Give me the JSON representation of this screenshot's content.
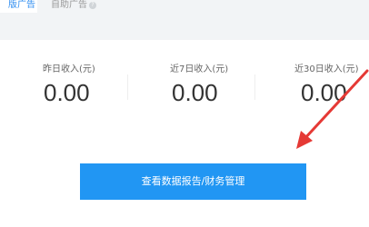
{
  "tabs": {
    "active_label": "版广告",
    "inactive_label": "自助广告"
  },
  "stats": [
    {
      "label": "昨日收入(元)",
      "value": "0.00"
    },
    {
      "label": "近7日收入(元)",
      "value": "0.00"
    },
    {
      "label": "近30日收入(元)",
      "value": "0.00"
    }
  ],
  "action": {
    "label": "查看数据报告/财务管理"
  },
  "colors": {
    "accent": "#2196f3",
    "annotation_arrow": "#e53935",
    "tabbar_background": "#f2f4f6"
  }
}
